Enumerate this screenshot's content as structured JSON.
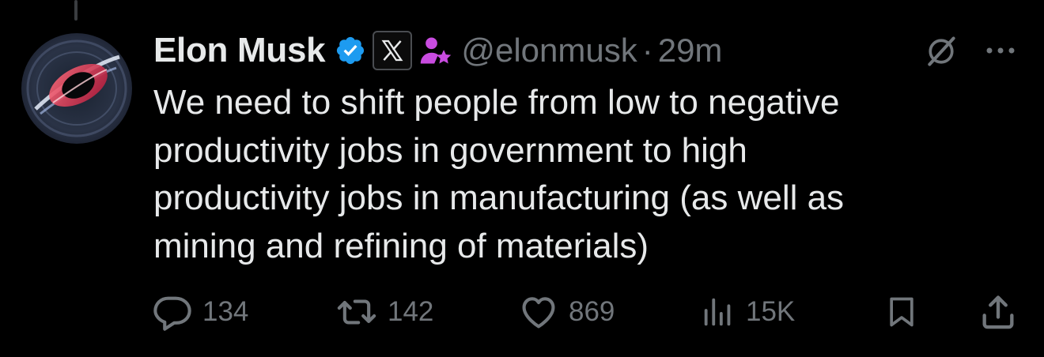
{
  "tweet": {
    "author": {
      "display_name": "Elon Musk",
      "handle": "@elonmusk",
      "verified": true,
      "affiliation_badge": "x-logo-badge",
      "extra_badge": "person-star-icon"
    },
    "separator": "·",
    "time": "29m",
    "text_lines": [
      "We need to shift people from low to negative",
      "productivity jobs in government to high",
      "productivity jobs in manufacturing (as well as",
      "mining and refining of materials)"
    ],
    "stats": {
      "replies": "134",
      "reposts": "142",
      "likes": "869",
      "views": "15K"
    }
  },
  "icons": {
    "reply": "speech-bubble-icon",
    "repost": "repost-arrows-icon",
    "like": "heart-icon",
    "views": "bar-chart-icon",
    "bookmark": "bookmark-icon",
    "share": "share-upload-icon",
    "grok": "grok-slash-circle-icon",
    "more": "more-dots-icon"
  },
  "colors": {
    "background": "#000000",
    "text_primary": "#e7e9ea",
    "text_secondary": "#71767b",
    "verified_blue": "#1d9bf0",
    "badge_purple": "#c94ce0"
  }
}
